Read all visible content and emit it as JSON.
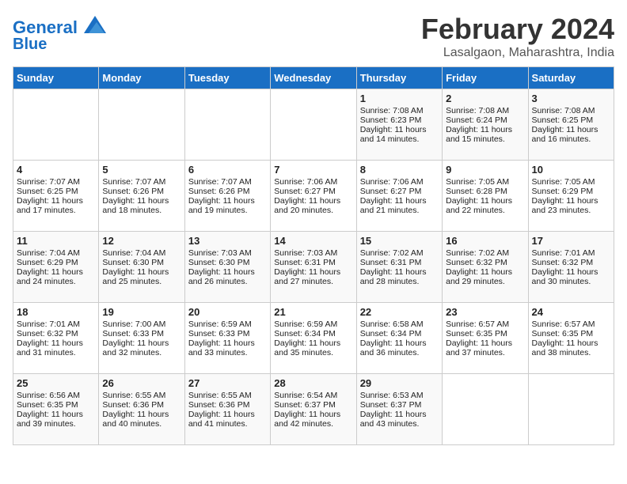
{
  "header": {
    "logo_line1": "General",
    "logo_line2": "Blue",
    "month_year": "February 2024",
    "location": "Lasalgaon, Maharashtra, India"
  },
  "weekdays": [
    "Sunday",
    "Monday",
    "Tuesday",
    "Wednesday",
    "Thursday",
    "Friday",
    "Saturday"
  ],
  "weeks": [
    [
      {
        "day": "",
        "sunrise": "",
        "sunset": "",
        "daylight": ""
      },
      {
        "day": "",
        "sunrise": "",
        "sunset": "",
        "daylight": ""
      },
      {
        "day": "",
        "sunrise": "",
        "sunset": "",
        "daylight": ""
      },
      {
        "day": "",
        "sunrise": "",
        "sunset": "",
        "daylight": ""
      },
      {
        "day": "1",
        "sunrise": "Sunrise: 7:08 AM",
        "sunset": "Sunset: 6:23 PM",
        "daylight": "Daylight: 11 hours and 14 minutes."
      },
      {
        "day": "2",
        "sunrise": "Sunrise: 7:08 AM",
        "sunset": "Sunset: 6:24 PM",
        "daylight": "Daylight: 11 hours and 15 minutes."
      },
      {
        "day": "3",
        "sunrise": "Sunrise: 7:08 AM",
        "sunset": "Sunset: 6:25 PM",
        "daylight": "Daylight: 11 hours and 16 minutes."
      }
    ],
    [
      {
        "day": "4",
        "sunrise": "Sunrise: 7:07 AM",
        "sunset": "Sunset: 6:25 PM",
        "daylight": "Daylight: 11 hours and 17 minutes."
      },
      {
        "day": "5",
        "sunrise": "Sunrise: 7:07 AM",
        "sunset": "Sunset: 6:26 PM",
        "daylight": "Daylight: 11 hours and 18 minutes."
      },
      {
        "day": "6",
        "sunrise": "Sunrise: 7:07 AM",
        "sunset": "Sunset: 6:26 PM",
        "daylight": "Daylight: 11 hours and 19 minutes."
      },
      {
        "day": "7",
        "sunrise": "Sunrise: 7:06 AM",
        "sunset": "Sunset: 6:27 PM",
        "daylight": "Daylight: 11 hours and 20 minutes."
      },
      {
        "day": "8",
        "sunrise": "Sunrise: 7:06 AM",
        "sunset": "Sunset: 6:27 PM",
        "daylight": "Daylight: 11 hours and 21 minutes."
      },
      {
        "day": "9",
        "sunrise": "Sunrise: 7:05 AM",
        "sunset": "Sunset: 6:28 PM",
        "daylight": "Daylight: 11 hours and 22 minutes."
      },
      {
        "day": "10",
        "sunrise": "Sunrise: 7:05 AM",
        "sunset": "Sunset: 6:29 PM",
        "daylight": "Daylight: 11 hours and 23 minutes."
      }
    ],
    [
      {
        "day": "11",
        "sunrise": "Sunrise: 7:04 AM",
        "sunset": "Sunset: 6:29 PM",
        "daylight": "Daylight: 11 hours and 24 minutes."
      },
      {
        "day": "12",
        "sunrise": "Sunrise: 7:04 AM",
        "sunset": "Sunset: 6:30 PM",
        "daylight": "Daylight: 11 hours and 25 minutes."
      },
      {
        "day": "13",
        "sunrise": "Sunrise: 7:03 AM",
        "sunset": "Sunset: 6:30 PM",
        "daylight": "Daylight: 11 hours and 26 minutes."
      },
      {
        "day": "14",
        "sunrise": "Sunrise: 7:03 AM",
        "sunset": "Sunset: 6:31 PM",
        "daylight": "Daylight: 11 hours and 27 minutes."
      },
      {
        "day": "15",
        "sunrise": "Sunrise: 7:02 AM",
        "sunset": "Sunset: 6:31 PM",
        "daylight": "Daylight: 11 hours and 28 minutes."
      },
      {
        "day": "16",
        "sunrise": "Sunrise: 7:02 AM",
        "sunset": "Sunset: 6:32 PM",
        "daylight": "Daylight: 11 hours and 29 minutes."
      },
      {
        "day": "17",
        "sunrise": "Sunrise: 7:01 AM",
        "sunset": "Sunset: 6:32 PM",
        "daylight": "Daylight: 11 hours and 30 minutes."
      }
    ],
    [
      {
        "day": "18",
        "sunrise": "Sunrise: 7:01 AM",
        "sunset": "Sunset: 6:32 PM",
        "daylight": "Daylight: 11 hours and 31 minutes."
      },
      {
        "day": "19",
        "sunrise": "Sunrise: 7:00 AM",
        "sunset": "Sunset: 6:33 PM",
        "daylight": "Daylight: 11 hours and 32 minutes."
      },
      {
        "day": "20",
        "sunrise": "Sunrise: 6:59 AM",
        "sunset": "Sunset: 6:33 PM",
        "daylight": "Daylight: 11 hours and 33 minutes."
      },
      {
        "day": "21",
        "sunrise": "Sunrise: 6:59 AM",
        "sunset": "Sunset: 6:34 PM",
        "daylight": "Daylight: 11 hours and 35 minutes."
      },
      {
        "day": "22",
        "sunrise": "Sunrise: 6:58 AM",
        "sunset": "Sunset: 6:34 PM",
        "daylight": "Daylight: 11 hours and 36 minutes."
      },
      {
        "day": "23",
        "sunrise": "Sunrise: 6:57 AM",
        "sunset": "Sunset: 6:35 PM",
        "daylight": "Daylight: 11 hours and 37 minutes."
      },
      {
        "day": "24",
        "sunrise": "Sunrise: 6:57 AM",
        "sunset": "Sunset: 6:35 PM",
        "daylight": "Daylight: 11 hours and 38 minutes."
      }
    ],
    [
      {
        "day": "25",
        "sunrise": "Sunrise: 6:56 AM",
        "sunset": "Sunset: 6:35 PM",
        "daylight": "Daylight: 11 hours and 39 minutes."
      },
      {
        "day": "26",
        "sunrise": "Sunrise: 6:55 AM",
        "sunset": "Sunset: 6:36 PM",
        "daylight": "Daylight: 11 hours and 40 minutes."
      },
      {
        "day": "27",
        "sunrise": "Sunrise: 6:55 AM",
        "sunset": "Sunset: 6:36 PM",
        "daylight": "Daylight: 11 hours and 41 minutes."
      },
      {
        "day": "28",
        "sunrise": "Sunrise: 6:54 AM",
        "sunset": "Sunset: 6:37 PM",
        "daylight": "Daylight: 11 hours and 42 minutes."
      },
      {
        "day": "29",
        "sunrise": "Sunrise: 6:53 AM",
        "sunset": "Sunset: 6:37 PM",
        "daylight": "Daylight: 11 hours and 43 minutes."
      },
      {
        "day": "",
        "sunrise": "",
        "sunset": "",
        "daylight": ""
      },
      {
        "day": "",
        "sunrise": "",
        "sunset": "",
        "daylight": ""
      }
    ]
  ]
}
